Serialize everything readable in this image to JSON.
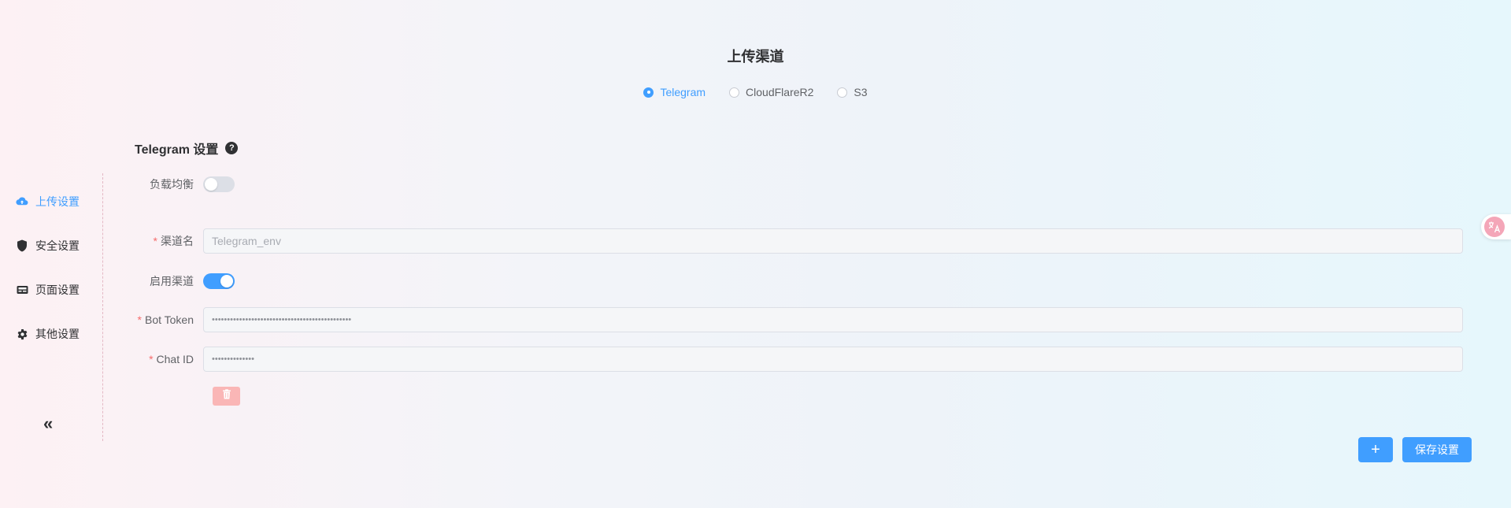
{
  "header": {
    "title": "上传渠道",
    "channels": [
      {
        "label": "Telegram",
        "selected": true
      },
      {
        "label": "CloudFlareR2",
        "selected": false
      },
      {
        "label": "S3",
        "selected": false
      }
    ]
  },
  "sidebar": {
    "items": [
      {
        "label": "上传设置",
        "icon": "cloud-upload-icon",
        "active": true
      },
      {
        "label": "安全设置",
        "icon": "shield-icon",
        "active": false
      },
      {
        "label": "页面设置",
        "icon": "monitor-icon",
        "active": false
      },
      {
        "label": "其他设置",
        "icon": "gear-icon",
        "active": false
      }
    ],
    "collapse_label": "«"
  },
  "section": {
    "title": "Telegram 设置",
    "help_icon": "?"
  },
  "form": {
    "load_balance_label": "负载均衡",
    "load_balance_on": false,
    "channel_name_label": "渠道名",
    "channel_name_value": "Telegram_env",
    "enable_label": "启用渠道",
    "enable_on": true,
    "bot_token_label": "Bot Token",
    "bot_token_value": "••••••••••••••••••••••••••••••••••••••••••••••",
    "chat_id_label": "Chat ID",
    "chat_id_value": "••••••••••••••"
  },
  "actions": {
    "add_label": "+",
    "save_label": "保存设置"
  },
  "colors": {
    "primary": "#409eff",
    "danger_light": "#fab6b6",
    "required": "#f56c6c"
  }
}
